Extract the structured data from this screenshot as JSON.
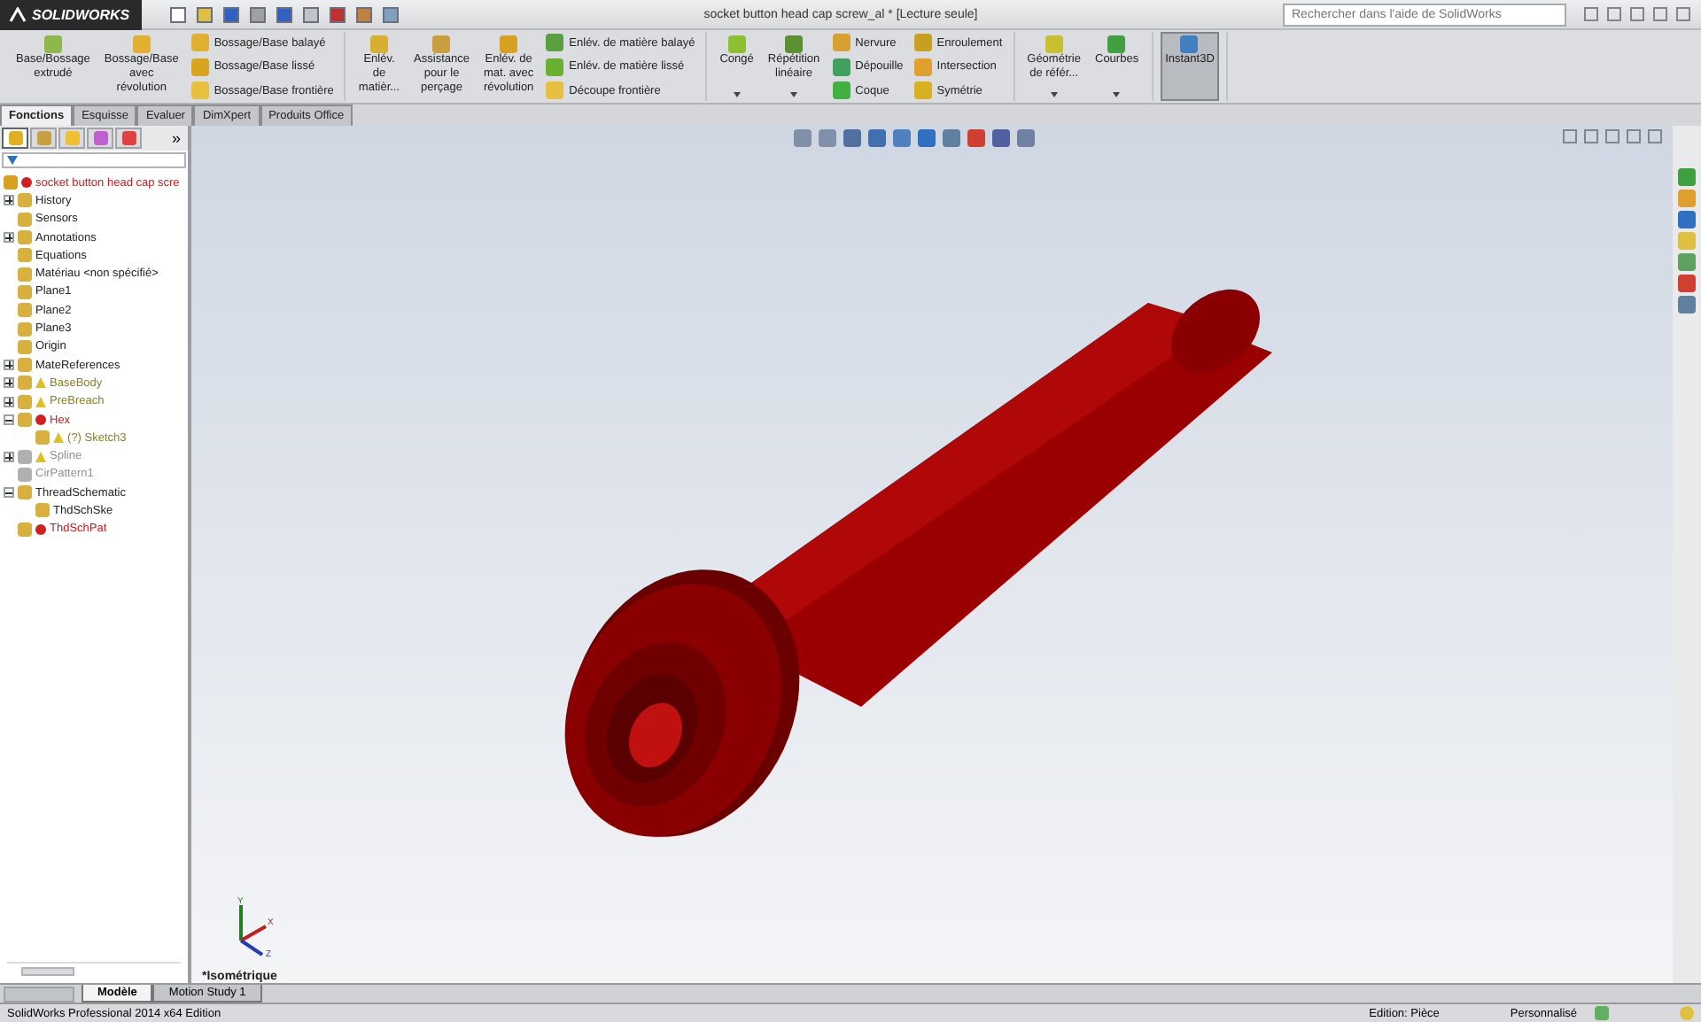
{
  "app": {
    "logo": "SOLIDWORKS",
    "title": "socket button head cap screw_al * [Lecture seule]",
    "search": {
      "placeholder": "Rechercher dans l'aide de SolidWorks"
    }
  },
  "ribbon": {
    "groups": [
      {
        "big": [
          {
            "label": "Base/Bossage\nextrudé",
            "color": "#8fb84a",
            "dropdown": false
          },
          {
            "label": "Bossage/Base\navec\nrévolution",
            "color": "#e0b030",
            "dropdown": false
          }
        ],
        "small": [
          [
            {
              "label": "Bossage/Base balayé",
              "color": "#e0b030"
            },
            {
              "label": "Bossage/Base lissé",
              "color": "#d9a520"
            },
            {
              "label": "Bossage/Base frontière",
              "color": "#e8c040"
            }
          ]
        ]
      },
      {
        "big": [
          {
            "label": "Enlév.\nde\nmatièr...",
            "color": "#d8b030",
            "dropdown": false
          },
          {
            "label": "Assistance\npour le\nperçage",
            "color": "#c8a040",
            "dropdown": false
          },
          {
            "label": "Enlév. de\nmat. avec\nrévolution",
            "color": "#d8a020",
            "dropdown": false
          }
        ],
        "small": [
          [
            {
              "label": "Enlév. de matière balayé",
              "color": "#5aa040"
            },
            {
              "label": "Enlév. de matière lissé",
              "color": "#6ab030"
            },
            {
              "label": "Découpe frontière",
              "color": "#e8c040"
            }
          ]
        ]
      },
      {
        "big": [
          {
            "label": "Congé",
            "color": "#8cc030",
            "dropdown": true
          },
          {
            "label": "Répétition\nlinéaire",
            "color": "#5a9030",
            "dropdown": true
          }
        ],
        "small": [
          [
            {
              "label": "Nervure",
              "color": "#d8a030"
            },
            {
              "label": "Dépouille",
              "color": "#40a060"
            },
            {
              "label": "Coque",
              "color": "#40b040"
            }
          ],
          [
            {
              "label": "Enroulement",
              "color": "#c8a020"
            },
            {
              "label": "Intersection",
              "color": "#e0a030"
            },
            {
              "label": "Symétrie",
              "color": "#d8b020"
            }
          ]
        ]
      },
      {
        "big": [
          {
            "label": "Géométrie\nde référ...",
            "color": "#c8c030",
            "dropdown": true
          },
          {
            "label": "Courbes",
            "color": "#40a040",
            "dropdown": true
          }
        ]
      },
      {
        "big": [
          {
            "label": "Instant3D",
            "color": "#4080c0",
            "dropdown": false,
            "selected": true
          }
        ]
      }
    ]
  },
  "command_tabs": [
    {
      "label": "Fonctions",
      "selected": true
    },
    {
      "label": "Esquisse",
      "selected": false
    },
    {
      "label": "Evaluer",
      "selected": false
    },
    {
      "label": "DimXpert",
      "selected": false
    },
    {
      "label": "Produits Office",
      "selected": false
    }
  ],
  "feature_manager": {
    "tabs": [
      {
        "selected": true
      },
      {
        "selected": false
      },
      {
        "selected": false
      },
      {
        "selected": false
      },
      {
        "selected": false
      }
    ],
    "more": "»",
    "root": {
      "label": "socket button head cap scre",
      "error": true
    },
    "items": [
      {
        "label": "History",
        "expandable": true,
        "expanded": false,
        "warning": false,
        "error": false,
        "suppressed": false
      },
      {
        "label": "Sensors",
        "expandable": false,
        "warning": false,
        "error": false,
        "suppressed": false
      },
      {
        "label": "Annotations",
        "expandable": true,
        "expanded": false,
        "warning": false,
        "error": false,
        "suppressed": false
      },
      {
        "label": "Equations",
        "expandable": false,
        "warning": false,
        "error": false,
        "suppressed": false
      },
      {
        "label": "Matériau <non spécifié>",
        "expandable": false,
        "warning": false,
        "error": false,
        "suppressed": false
      },
      {
        "label": "Plane1",
        "expandable": false,
        "warning": false,
        "error": false,
        "suppressed": false
      },
      {
        "label": "Plane2",
        "expandable": false,
        "warning": false,
        "error": false,
        "suppressed": false
      },
      {
        "label": "Plane3",
        "expandable": false,
        "warning": false,
        "error": false,
        "suppressed": false
      },
      {
        "label": "Origin",
        "expandable": false,
        "warning": false,
        "error": false,
        "suppressed": false
      },
      {
        "label": "MateReferences",
        "expandable": true,
        "expanded": false,
        "warning": false,
        "error": false,
        "suppressed": false
      },
      {
        "label": "BaseBody",
        "expandable": true,
        "expanded": false,
        "warning": true,
        "error": false,
        "suppressed": false
      },
      {
        "label": "PreBreach",
        "expandable": true,
        "expanded": false,
        "warning": true,
        "error": false,
        "suppressed": false
      },
      {
        "label": "Hex",
        "expandable": true,
        "expanded": true,
        "warning": false,
        "error": true,
        "suppressed": false,
        "children": [
          {
            "label": "(?) Sketch3",
            "expandable": false,
            "warning": true,
            "error": false,
            "suppressed": false
          }
        ]
      },
      {
        "label": "Spline",
        "expandable": true,
        "expanded": false,
        "warning": true,
        "error": false,
        "suppressed": true
      },
      {
        "label": "CirPattern1",
        "expandable": false,
        "warning": false,
        "error": false,
        "suppressed": true
      },
      {
        "label": "ThreadSchematic",
        "expandable": true,
        "expanded": true,
        "warning": false,
        "error": false,
        "suppressed": false,
        "children": [
          {
            "label": "ThdSchSke",
            "expandable": false,
            "warning": false,
            "error": false,
            "suppressed": false
          }
        ]
      },
      {
        "label": "ThdSchPat",
        "expandable": false,
        "warning": false,
        "error": true,
        "suppressed": false
      }
    ]
  },
  "viewport": {
    "view_name": "*Isométrique",
    "axes": [
      "X",
      "Y",
      "Z"
    ]
  },
  "bottom_tabs": [
    {
      "label": "Modèle",
      "selected": true
    },
    {
      "label": "Motion Study 1",
      "selected": false
    }
  ],
  "status_bar": {
    "product": "SolidWorks Professional 2014 x64 Edition",
    "mode": "Edition: Pièce",
    "units": "Personnalisé"
  }
}
